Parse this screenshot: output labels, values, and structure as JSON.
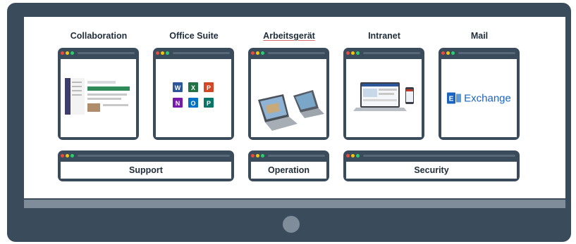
{
  "categories": {
    "collaboration": "Collaboration",
    "office_suite": "Office Suite",
    "arbeitsgeraet": "Arbeitsgerät",
    "intranet": "Intranet",
    "mail": "Mail"
  },
  "bottom_windows": {
    "support": "Support",
    "operation": "Operation",
    "security": "Security"
  },
  "mail_window": {
    "exchange_label": "Exchange"
  },
  "office_apps": [
    "word",
    "excel",
    "powerpoint",
    "onenote",
    "outlook",
    "publisher"
  ],
  "colors": {
    "frame": "#3a4b5c",
    "bezel": "#7f8d9b",
    "dot_red": "#e74c3c",
    "dot_yellow": "#f1c40f",
    "dot_green": "#2ecc71",
    "exchange_blue": "#1a64c0"
  }
}
